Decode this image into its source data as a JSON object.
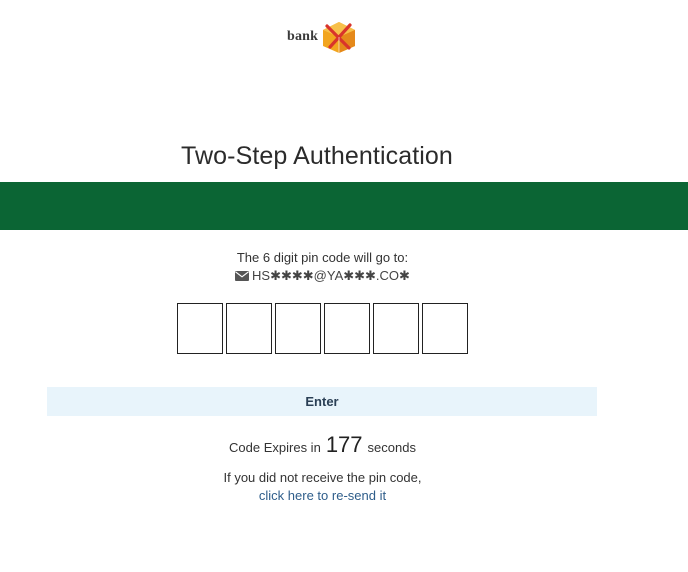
{
  "brand": {
    "name": "bank",
    "logo_icon": "cube-logo-icon"
  },
  "page": {
    "title": "Two-Step Authentication",
    "band_color": "#0b6534"
  },
  "destination": {
    "label": "The 6 digit pin code will go to:",
    "icon": "envelope-icon",
    "masked_email": "HS✱✱✱✱@YA✱✱✱.CO✱"
  },
  "pin": {
    "digits": [
      "",
      "",
      "",
      "",
      "",
      ""
    ]
  },
  "actions": {
    "enter_label": "Enter",
    "enter_bg": "#e8f4fb"
  },
  "expiry": {
    "prefix": "Code Expires in",
    "seconds": "177",
    "suffix": "seconds"
  },
  "resend": {
    "text": "If you did not receive the pin code,",
    "link_label": "click here to re-send it",
    "link_color": "#2e5d8a"
  }
}
